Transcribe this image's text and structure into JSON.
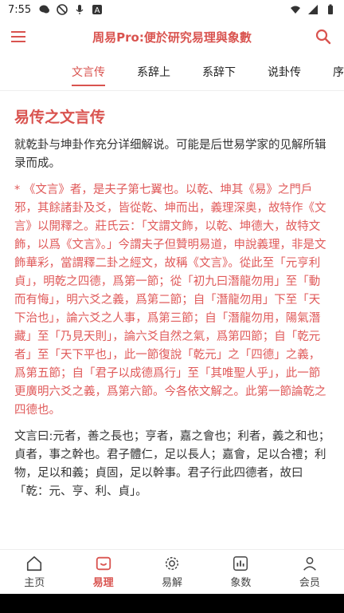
{
  "status": {
    "time": "7:55"
  },
  "app_bar": {
    "title": "周易Pro:便於研究易理與象數"
  },
  "tabs": [
    {
      "label": "文言传",
      "active": true
    },
    {
      "label": "系辞上",
      "active": false
    },
    {
      "label": "系辞下",
      "active": false
    },
    {
      "label": "说卦传",
      "active": false
    },
    {
      "label": "序卦传",
      "active": false
    }
  ],
  "content": {
    "heading": "易传之文言传",
    "intro": "就乾卦与坤卦作充分详细解说。可能是后世易学家的见解所辑录而成。",
    "note": "* 《文言》者，是夫子第七翼也。以乾、坤其《易》之門戶邪，其餘諸卦及爻，皆從乾、坤而出，義理深奥，故特作《文言》以開釋之。莊氏云：「文謂文飾，以乾、坤德大，故特文飾，以爲《文言》。」今謂夫子但贊明易道，申說義理，非是文飾華彩，當謂釋二卦之經文，故稱《文言》。從此至「元亨利貞」，明乾之四德，爲第一節；從「初九曰潛龍勿用」至「動而有悔」，明六爻之義，爲第二節；自「潛龍勿用」下至「天下治也」，論六爻之人事，爲第三節；自「潛龍勿用，陽氣潛藏」至「乃見天則」，論六爻自然之氣，爲第四節；自「乾元者」至「天下平也」，此一節復說「乾元」之「四德」之義，爲第五節；自「君子以成德爲行」至「其唯聖人乎」，此一節更廣明六爻之義，爲第六節。今各依文解之。此第一節論乾之四德也。",
    "main_text": "文言曰:元者，善之長也；亨者，嘉之會也；利者，義之和也；貞者，事之幹也。君子體仁，足以長人；嘉會，足以合禮；利物，足以和義；貞固，足以幹事。君子行此四德者，故曰「乾：元、亨、利、貞」。"
  },
  "bottom_nav": [
    {
      "label": "主页",
      "icon": "home-icon",
      "active": false
    },
    {
      "label": "易理",
      "icon": "book-icon",
      "active": true
    },
    {
      "label": "易解",
      "icon": "compass-icon",
      "active": false
    },
    {
      "label": "象数",
      "icon": "chart-icon",
      "active": false
    },
    {
      "label": "会员",
      "icon": "user-icon",
      "active": false
    }
  ],
  "colors": {
    "accent": "#d9534f",
    "note_text": "#e05a5a"
  }
}
